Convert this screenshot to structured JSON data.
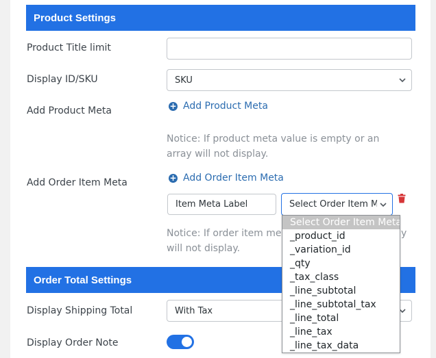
{
  "product_settings": {
    "header": "Product Settings",
    "title_limit": {
      "label": "Product Title limit",
      "value": ""
    },
    "display_id_sku": {
      "label": "Display ID/SKU",
      "value": "SKU"
    },
    "product_meta": {
      "label": "Add Product Meta",
      "add_link": "Add Product Meta",
      "notice": "Notice: If product meta value is empty or an array will not display."
    },
    "order_item_meta": {
      "label": "Add Order Item Meta",
      "add_link": "Add Order Item Meta",
      "meta_label_value": "Item Meta Label",
      "select_value": "Select Order Item Meta",
      "notice_left": "Notice: If order item meta",
      "notice_right": "y",
      "notice_line2": "will not display.",
      "dropdown_options": [
        "Select Order Item Meta",
        "_product_id",
        "_variation_id",
        "_qty",
        "_tax_class",
        "_line_subtotal",
        "_line_subtotal_tax",
        "_line_total",
        "_line_tax",
        "_line_tax_data"
      ]
    }
  },
  "order_total_settings": {
    "header": "Order Total Settings",
    "shipping_total": {
      "label": "Display Shipping Total",
      "value": "With Tax"
    },
    "order_note": {
      "label": "Display Order Note",
      "enabled": true
    }
  },
  "colors": {
    "header_bg": "#2271e4",
    "link": "#2b6cb0",
    "delete": "#d63638"
  }
}
